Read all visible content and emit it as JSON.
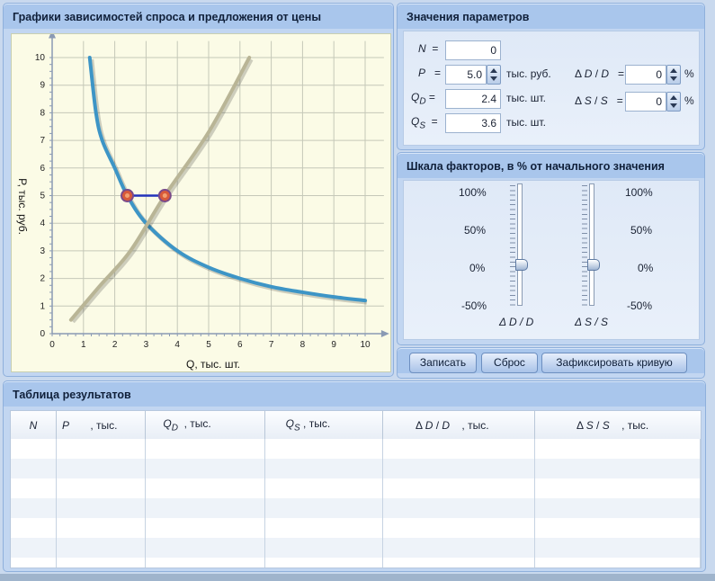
{
  "chart_panel": {
    "title": "Графики зависимостей спроса и предложения от цены",
    "x_label": "Q, тыс. шт.",
    "y_label": "P, тыс. руб."
  },
  "chart_data": {
    "type": "line",
    "xlabel": "Q, тыс. шт.",
    "ylabel": "P, тыс. руб.",
    "xlim": [
      0,
      10
    ],
    "ylim": [
      0,
      10
    ],
    "x_ticks": [
      "0",
      "1",
      "2",
      "3",
      "4",
      "5",
      "6",
      "7",
      "8",
      "9",
      "10"
    ],
    "y_ticks": [
      "0",
      "1",
      "2",
      "3",
      "4",
      "5",
      "6",
      "7",
      "8",
      "9",
      "10"
    ],
    "grid": true,
    "series": [
      {
        "role": "demand",
        "color": "#3d95c6",
        "points": [
          [
            1.2,
            10
          ],
          [
            1.4,
            8
          ],
          [
            1.6,
            7
          ],
          [
            2,
            6
          ],
          [
            2.4,
            5
          ],
          [
            3,
            4
          ],
          [
            4,
            3
          ],
          [
            5,
            2.4
          ],
          [
            6,
            2
          ],
          [
            7,
            1.7
          ],
          [
            8,
            1.5
          ],
          [
            9,
            1.33
          ],
          [
            10,
            1.2
          ]
        ]
      },
      {
        "role": "supply",
        "color": "#b9b596",
        "points": [
          [
            0.6,
            0.5
          ],
          [
            1.5,
            1.7
          ],
          [
            2.5,
            3
          ],
          [
            3.6,
            5
          ],
          [
            5,
            7.3
          ],
          [
            6.3,
            10
          ]
        ]
      }
    ],
    "markers": [
      {
        "q": 2.4,
        "p": 5
      },
      {
        "q": 3.6,
        "p": 5
      }
    ],
    "gap_segment": {
      "from_q": 2.4,
      "to_q": 3.6,
      "p": 5,
      "color": "#2233bb"
    }
  },
  "params": {
    "title": "Значения параметров",
    "n_value": "0",
    "p_value": "5.0",
    "p_unit": "тыс. руб.",
    "qd_value": "2.4",
    "qd_unit": "тыс. шт.",
    "qs_value": "3.6",
    "qs_unit": "тыс. шт.",
    "dd_value": "0",
    "ds_value": "0",
    "percent": "%"
  },
  "factors": {
    "title": "Шкала факторов, в % от начального значения",
    "scale": [
      "100%",
      "50%",
      "0%",
      "-50%"
    ],
    "dd_caption": "Δ D / D",
    "ds_caption": "Δ S / S",
    "dd_level_percent": 0,
    "ds_level_percent": 0
  },
  "buttons": {
    "record": "Записать",
    "reset": "Сброс",
    "fix_curve": "Зафиксировать кривую"
  },
  "results": {
    "title": "Таблица результатов",
    "unit": ", тыс."
  }
}
